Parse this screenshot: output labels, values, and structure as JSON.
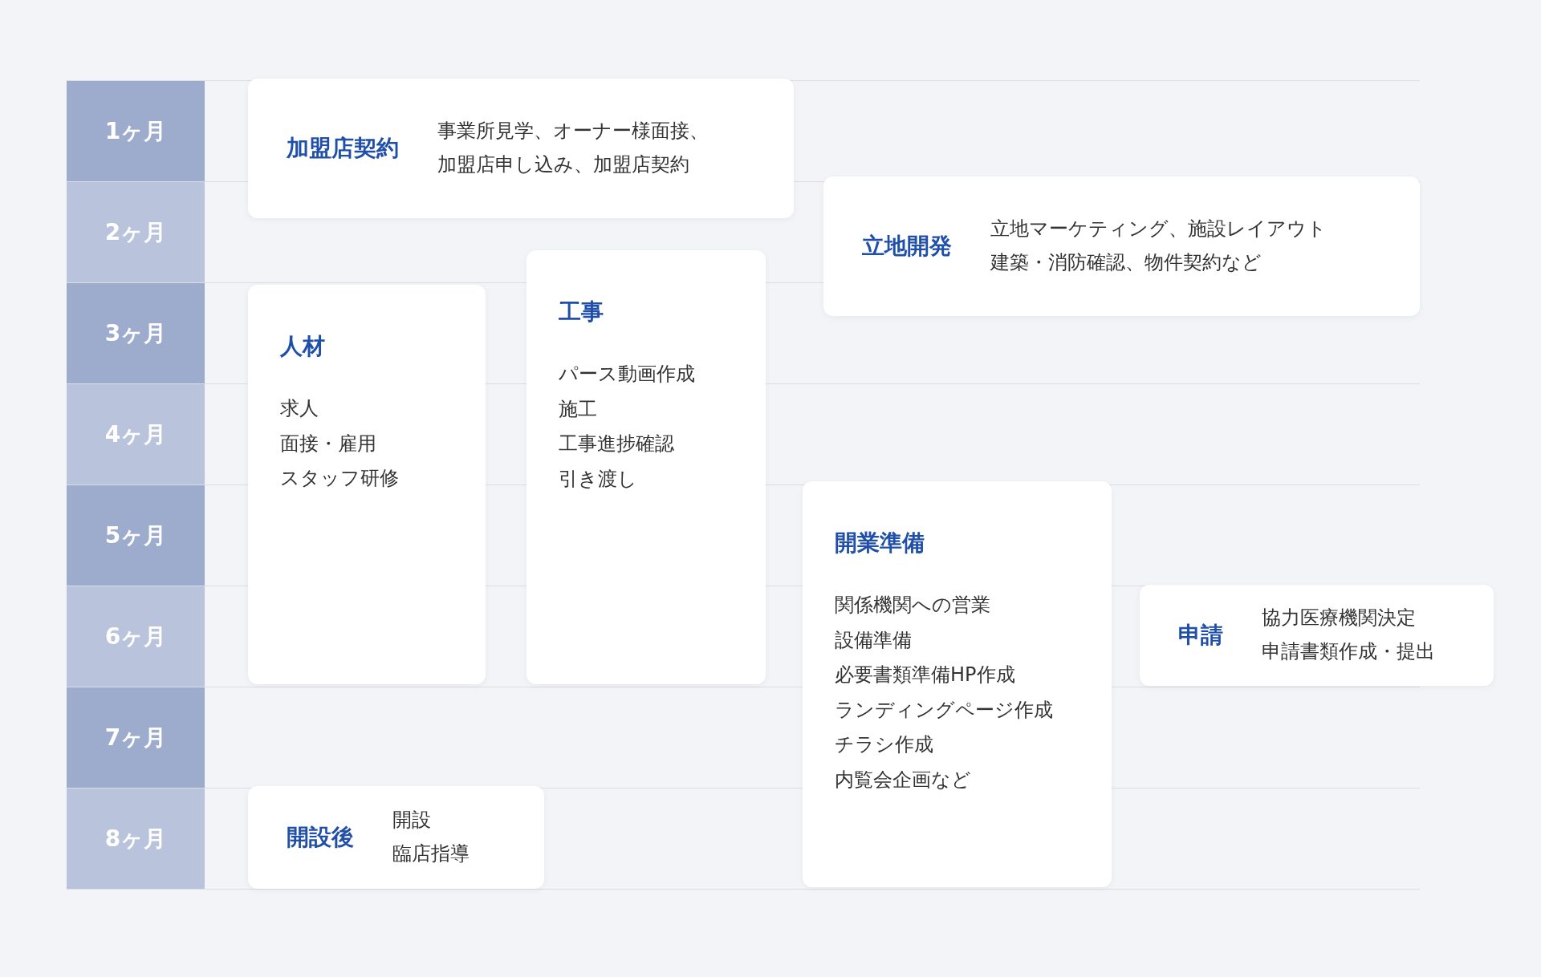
{
  "months": [
    {
      "label": "1ヶ月",
      "color": "#9dabcd"
    },
    {
      "label": "2ヶ月",
      "color": "#b9c4dc"
    },
    {
      "label": "3ヶ月",
      "color": "#9dabcd"
    },
    {
      "label": "4ヶ月",
      "color": "#b9c4dc"
    },
    {
      "label": "5ヶ月",
      "color": "#9dabcd"
    },
    {
      "label": "6ヶ月",
      "color": "#b9c4dc"
    },
    {
      "label": "7ヶ月",
      "color": "#9dabcd"
    },
    {
      "label": "8ヶ月",
      "color": "#b9c4dc"
    }
  ],
  "phases": [
    {
      "kind": "wide",
      "title": "加盟店契約",
      "items": [
        "事業所見学、オーナー様面接、",
        "加盟店申し込み、加盟店契約"
      ]
    },
    {
      "kind": "wide",
      "title": "立地開発",
      "items": [
        "立地マーケティング、施設レイアウト",
        "建築・消防確認、物件契約など"
      ]
    },
    {
      "kind": "tall",
      "title": "人材",
      "items": [
        "求人",
        "面接・雇用",
        "スタッフ研修"
      ]
    },
    {
      "kind": "tall",
      "title": "工事",
      "items": [
        "パース動画作成",
        "施工",
        "工事進捗確認",
        "引き渡し"
      ]
    },
    {
      "kind": "tall",
      "title": "開業準備",
      "items": [
        "関係機関への営業",
        "設備準備",
        "必要書類準備HP作成",
        "ランディングページ作成",
        "チラシ作成",
        "内覧会企画など"
      ]
    },
    {
      "kind": "wide",
      "title": "申請",
      "items": [
        "協力医療機関決定",
        "申請書類作成・提出"
      ]
    },
    {
      "kind": "wide",
      "title": "開設後",
      "items": [
        "開設",
        "臨店指導"
      ]
    }
  ]
}
